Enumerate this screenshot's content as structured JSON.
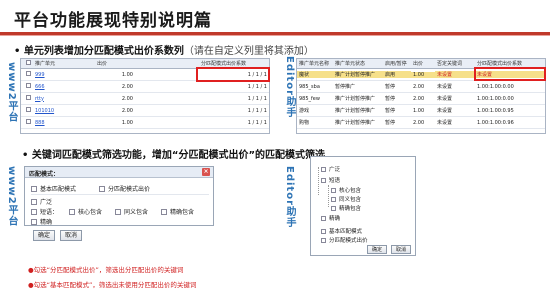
{
  "title": "平台功能展现特别说明篇",
  "section1": {
    "bullet": "•",
    "text": "单元列表增加分匹配模式出价系数列",
    "note": "（请在自定义列里将其添加）"
  },
  "section2": {
    "bullet": "•",
    "text": "关键词匹配模式筛选功能，增加“分匹配模式出价”的匹配模式筛选"
  },
  "labels": {
    "www2_top": "www2平台",
    "editor_top": "Editor助手",
    "www2_bottom": "www2平台",
    "editor_bottom": "Editor助手"
  },
  "grid_left": {
    "headers": [
      "",
      "推广单元",
      "出价",
      "",
      "分匹配模式出价系数"
    ],
    "rows": [
      {
        "name": "999",
        "bid": "1.00",
        "coef": "1 / 1 / 1"
      },
      {
        "name": "666",
        "bid": "2.00",
        "coef": "1 / 1 / 1"
      },
      {
        "name": "rtty",
        "bid": "2.00",
        "coef": "1 / 1 / 1"
      },
      {
        "name": "101010",
        "bid": "2.00",
        "coef": "1 / 1 / 1"
      },
      {
        "name": "888",
        "bid": "1.00",
        "coef": "1 / 1 / 1"
      }
    ]
  },
  "grid_right": {
    "headers": [
      "推广单元名称",
      "推广单元状态",
      "启用/暂停",
      "出价",
      "否定关键词",
      "分匹配模式出价系数"
    ],
    "rows": [
      {
        "name": "魔状",
        "status": "推广计划暂停推广",
        "toggle": "启用",
        "bid": "1.00",
        "neg": "未设置",
        "coef": "未设置"
      },
      {
        "name": "985_sba",
        "status": "暂停推广",
        "toggle": "暂停",
        "bid": "2.00",
        "neg": "未设置",
        "coef": "1.00:1.00:0.00"
      },
      {
        "name": "985_few",
        "status": "推广计划暂停推广",
        "toggle": "暂停",
        "bid": "2.00",
        "neg": "未设置",
        "coef": "1.00:1.00:0.00"
      },
      {
        "name": "游戏",
        "status": "推广计划暂停推广",
        "toggle": "暂停",
        "bid": "1.00",
        "neg": "未设置",
        "coef": "1.00:1.00:0.95"
      },
      {
        "name": "购物",
        "status": "推广计划暂停推广",
        "toggle": "暂停",
        "bid": "2.00",
        "neg": "未设置",
        "coef": "1.00:1.00:0.96"
      }
    ]
  },
  "dialog": {
    "title": "匹配模式：",
    "basic": "基本匹配模式",
    "split": "分匹配模式出价",
    "broad": "广泛",
    "phrase": "短语：",
    "core": "核心包含",
    "same": "同义包含",
    "precise": "精确包含",
    "exact": "精确",
    "ok": "确定",
    "cancel": "取消"
  },
  "tree": {
    "items": [
      "广泛",
      "短语",
      "核心包含",
      "同义包含",
      "精确包含",
      "精确",
      "基本匹配模式",
      "分匹配模式出价"
    ],
    "ok": "确定",
    "cancel": "取消"
  },
  "notes": [
    "●勾选“分匹配模式出价”，筛选出分匹配出价的关键词",
    "●勾选“基本匹配模式”，筛选出未使用分匹配出价的关键词"
  ],
  "colors": {
    "accent_red": "#e02020",
    "brand_blue": "#2e74b5",
    "highlight_yellow": "#f6e08a"
  }
}
